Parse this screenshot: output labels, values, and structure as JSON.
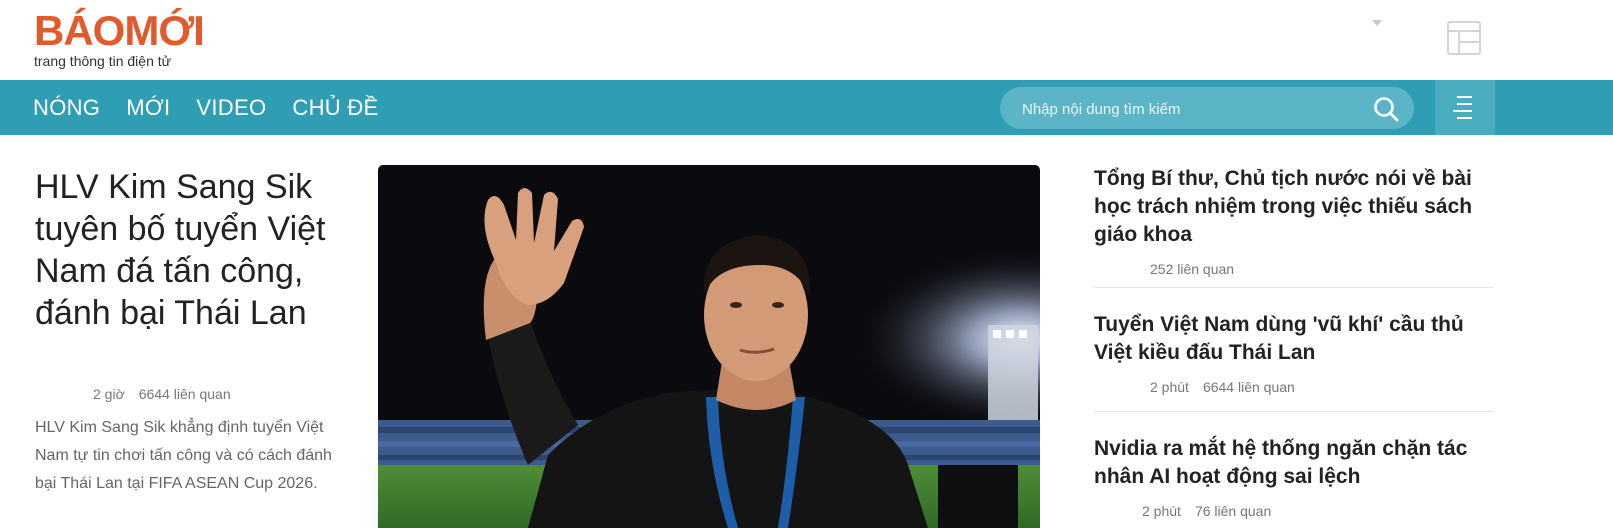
{
  "header": {
    "logo_text": "BÁOMỚI",
    "tagline": "trang thông tin điện tử"
  },
  "nav": {
    "items": [
      {
        "label": "NÓNG"
      },
      {
        "label": "MỚI"
      },
      {
        "label": "VIDEO"
      },
      {
        "label": "CHỦ ĐỀ"
      }
    ],
    "search_placeholder": "Nhập nội dung tìm kiếm",
    "accent_color": "#2f9db3"
  },
  "lead": {
    "title": "HLV Kim Sang Sik tuyên bố tuyển Việt Nam đá tấn công, đánh bại Thái Lan",
    "time": "2 giờ",
    "related": "6644 liên quan",
    "summary": "HLV Kim Sang Sik khẳng định tuyển Việt Nam tự tin chơi tấn công và có cách đánh bại Thái Lan tại FIFA ASEAN Cup 2026."
  },
  "side": {
    "items": [
      {
        "title": "Tổng Bí thư, Chủ tịch nước nói về bài học trách nhiệm trong việc thiếu sách giáo khoa",
        "time": "",
        "related": "252 liên quan"
      },
      {
        "title": "Tuyển Việt Nam dùng 'vũ khí' cầu thủ Việt kiều đấu Thái Lan",
        "time": "2 phút",
        "related": "6644 liên quan"
      },
      {
        "title": "Nvidia ra mắt hệ thống ngăn chặn tác nhân AI hoạt động sai lệch",
        "time": "2 phút",
        "related": "76 liên quan"
      }
    ]
  }
}
